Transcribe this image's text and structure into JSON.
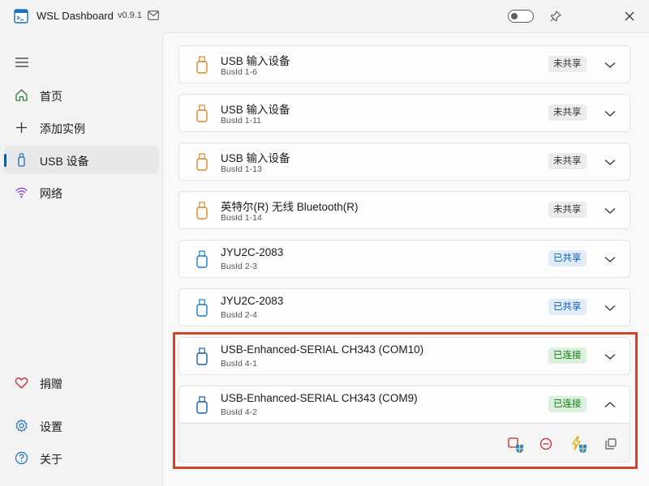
{
  "app": {
    "title": "WSL Dashboard",
    "version": "v0.9.1"
  },
  "sidebar": {
    "items": [
      {
        "label": "首页"
      },
      {
        "label": "添加实例"
      },
      {
        "label": "USB 设备"
      },
      {
        "label": "网络"
      }
    ],
    "bottom": [
      {
        "label": "捐赠"
      },
      {
        "label": "设置"
      },
      {
        "label": "关于"
      }
    ]
  },
  "devices": [
    {
      "name": "USB 输入设备",
      "busid": "BusId 1-6",
      "status": "未共享"
    },
    {
      "name": "USB 输入设备",
      "busid": "BusId 1-11",
      "status": "未共享"
    },
    {
      "name": "USB 输入设备",
      "busid": "BusId 1-13",
      "status": "未共享"
    },
    {
      "name": "英特尔(R) 无线 Bluetooth(R)",
      "busid": "BusId 1-14",
      "status": "未共享"
    },
    {
      "name": "JYU2C-2083",
      "busid": "BusId 2-3",
      "status": "已共享"
    },
    {
      "name": "JYU2C-2083",
      "busid": "BusId 2-4",
      "status": "已共享"
    },
    {
      "name": "USB-Enhanced-SERIAL CH343 (COM10)",
      "busid": "BusId 4-1",
      "status": "已连接"
    },
    {
      "name": "USB-Enhanced-SERIAL CH343 (COM9)",
      "busid": "BusId 4-2",
      "status": "已连接"
    }
  ],
  "colors": {
    "accent": "#005fb8",
    "unshared_icon": "#d98a2b",
    "shared_icon": "#1a7fd0",
    "connected_icon": "#1a5fb0",
    "highlight": "#d0432c"
  },
  "icons": {
    "home": "home-icon",
    "add": "plus-icon",
    "usb": "usb-icon",
    "network": "wifi-icon",
    "donate": "heart-icon",
    "settings": "gear-icon",
    "about": "help-icon",
    "detach": "stop-shield-icon",
    "unbind": "minus-circle-icon",
    "force": "lightning-shield-icon",
    "copy": "copy-icon"
  }
}
